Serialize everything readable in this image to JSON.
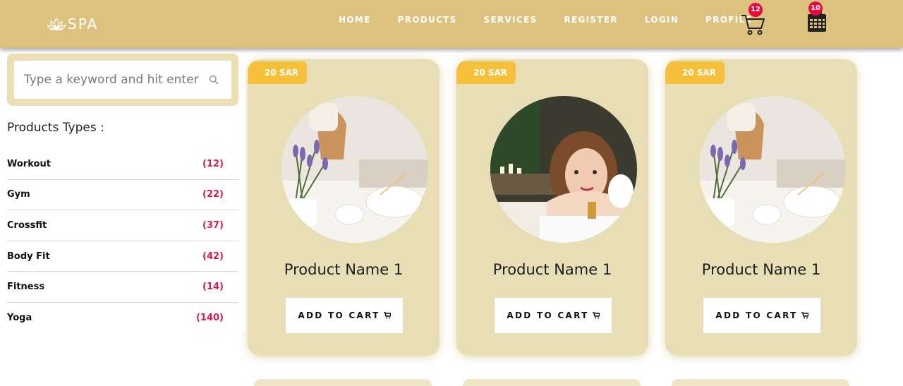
{
  "app": {
    "logo_text": "SPA",
    "logo_icon": "lotus-icon"
  },
  "nav": {
    "items": [
      {
        "label": "HOME"
      },
      {
        "label": "PRODUCTS"
      },
      {
        "label": "SERVICES"
      },
      {
        "label": "REGISTER"
      },
      {
        "label": "LOGIN"
      },
      {
        "label": "PROFILE"
      }
    ],
    "cart_count": "12",
    "calendar_count": "10"
  },
  "search": {
    "placeholder": "Type a keyword and hit enter",
    "value": ""
  },
  "sidebar": {
    "title": "Products Types :",
    "types": [
      {
        "name": "Workout",
        "count": "(12)"
      },
      {
        "name": "Gym",
        "count": "(22)"
      },
      {
        "name": "Crossfit",
        "count": "(37)"
      },
      {
        "name": "Body Fit",
        "count": "(42)"
      },
      {
        "name": "Fitness",
        "count": "(14)"
      },
      {
        "name": "Yoga",
        "count": "(140)"
      }
    ]
  },
  "products": [
    {
      "price": "20 SAR",
      "name": "Product Name 1",
      "button": "ADD TO CART",
      "image": "spa-lavender-photo"
    },
    {
      "price": "20 SAR",
      "name": "Product Name 1",
      "button": "ADD TO CART",
      "image": "spa-woman-photo"
    },
    {
      "price": "20 SAR",
      "name": "Product Name 1",
      "button": "ADD TO CART",
      "image": "spa-lavender-photo"
    }
  ],
  "colors": {
    "header": "#dcc27e",
    "card": "#e8deb6",
    "price_tag": "#f6c03b",
    "badge": "#e5093f",
    "count": "#d81b4f"
  }
}
